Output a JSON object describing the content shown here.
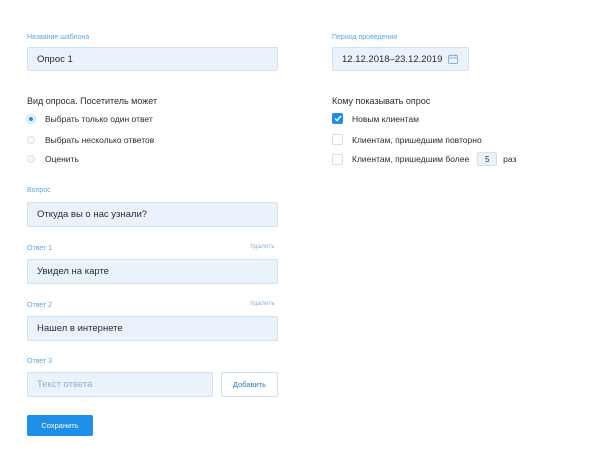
{
  "template_name": {
    "label": "Название шаблона",
    "value": "Опрос 1"
  },
  "period": {
    "label": "Период проведения",
    "value": "12.12.2018–23.12.2019",
    "icon": "calendar-icon"
  },
  "survey_type": {
    "title": "Вид опроса. Посетитель может",
    "options": [
      {
        "label": "Выбрать только один ответ",
        "selected": true
      },
      {
        "label": "Выбрать несколько ответов",
        "selected": false
      },
      {
        "label": "Оценить",
        "selected": false
      }
    ]
  },
  "audience": {
    "title": "Кому показывать опрос",
    "options": [
      {
        "label": "Новым клиентам",
        "checked": true
      },
      {
        "label": "Клиентам, пришедшим повторно",
        "checked": false
      },
      {
        "label": "Клиентам, пришедшим более",
        "checked": false,
        "times_value": "5",
        "times_suffix": "раз"
      }
    ]
  },
  "question": {
    "label": "Вопрос",
    "value": "Откуда вы о нас узнали?"
  },
  "answers": [
    {
      "label": "Ответ 1",
      "value": "Увидел на карте",
      "delete_label": "Удалить"
    },
    {
      "label": "Ответ 2",
      "value": "Нашел в интернете",
      "delete_label": "Удалить"
    },
    {
      "label": "Ответ 3",
      "placeholder": "Текст ответа",
      "add_label": "Добавить"
    }
  ],
  "save_label": "Сохранить",
  "colors": {
    "accent": "#1e8ee8",
    "field_bg": "#eaf3fb",
    "label": "#5aa7e6"
  }
}
